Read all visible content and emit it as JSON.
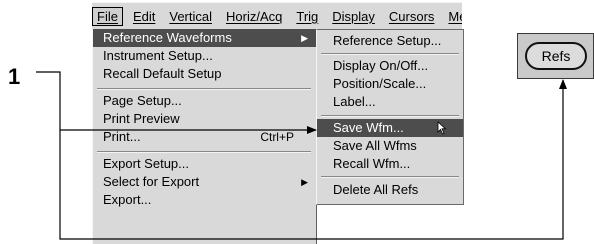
{
  "callout": {
    "number": "1"
  },
  "menubar": {
    "items": [
      {
        "label": "File"
      },
      {
        "label": "Edit"
      },
      {
        "label": "Vertical"
      },
      {
        "label": "Horiz/Acq"
      },
      {
        "label": "Trig"
      },
      {
        "label": "Display"
      },
      {
        "label": "Cursors"
      },
      {
        "label": "Meas"
      }
    ]
  },
  "file_menu": {
    "items": [
      {
        "label": "Reference Waveforms",
        "has_submenu": true
      },
      {
        "label": "Instrument Setup..."
      },
      {
        "label": "Recall Default Setup"
      },
      {
        "label": "Page Setup..."
      },
      {
        "label": "Print Preview"
      },
      {
        "label": "Print...",
        "accelerator": "Ctrl+P"
      },
      {
        "label": "Export Setup..."
      },
      {
        "label": "Select for Export",
        "has_submenu": true
      },
      {
        "label": "Export..."
      }
    ]
  },
  "submenu": {
    "items": [
      {
        "label": "Reference Setup..."
      },
      {
        "label": "Display On/Off..."
      },
      {
        "label": "Position/Scale..."
      },
      {
        "label": "Label..."
      },
      {
        "label": "Save Wfm..."
      },
      {
        "label": "Save All Wfms"
      },
      {
        "label": "Recall Wfm..."
      },
      {
        "label": "Delete All Refs"
      }
    ]
  },
  "refs_button": {
    "label": "Refs"
  },
  "colors": {
    "menu_bg": "#d9d9d9",
    "highlight": "#4d4d4d"
  }
}
